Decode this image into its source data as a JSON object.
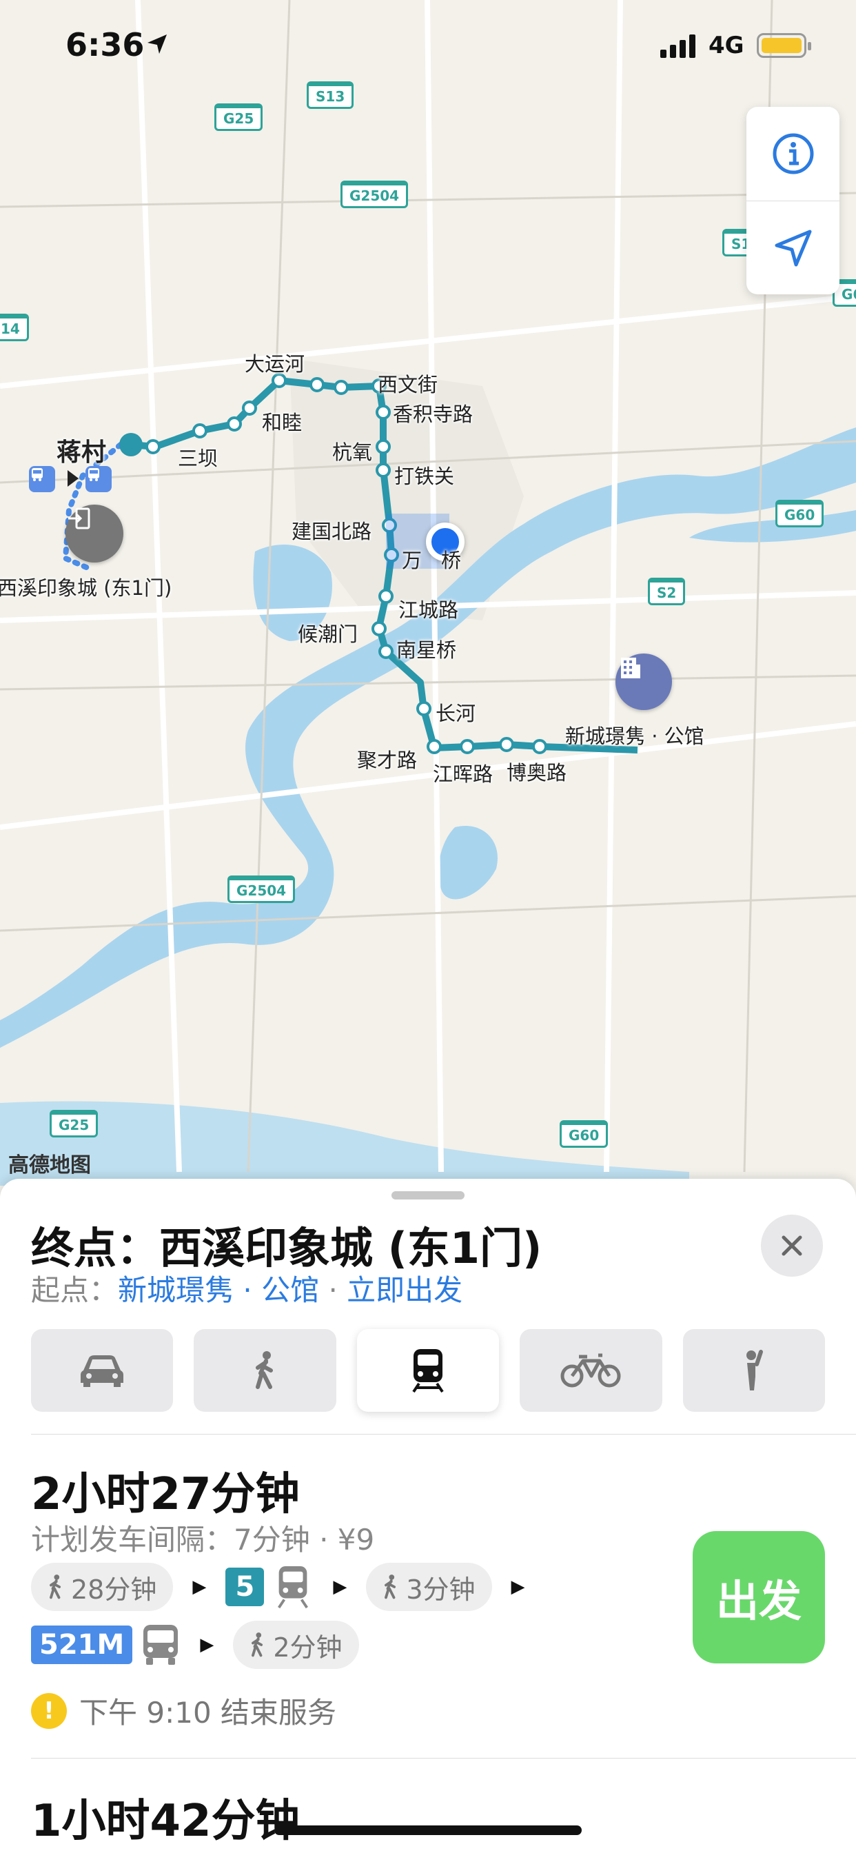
{
  "status": {
    "time": "6:36",
    "network": "4G"
  },
  "map": {
    "provider": "高德地图",
    "highways": [
      "S13",
      "G25",
      "G2504",
      "S1",
      "G6",
      "G60",
      "S2",
      "G2504",
      "G25",
      "G60",
      "14"
    ],
    "stations": [
      "大运河",
      "西文街",
      "香积寺路",
      "和睦",
      "三坝",
      "杭氧",
      "打铁关",
      "建国北路",
      "万",
      "桥",
      "江城路",
      "候潮门",
      "南星桥",
      "长河",
      "聚才路",
      "江晖路",
      "博奥路"
    ],
    "labels": {
      "start_place": "蒋村",
      "destination_pin": "西溪印象城 (东1门)",
      "origin_pin": "新城璟隽 · 公馆"
    }
  },
  "controls": {
    "info_icon": "info-icon",
    "locate_icon": "location-arrow-icon"
  },
  "sheet": {
    "title": "终点：西溪印象城 (东1门)",
    "start_prefix": "起点：",
    "start_value": "新城璟隽 · 公馆",
    "dot": "·",
    "depart_now": "立即出发",
    "modes": [
      "car",
      "walk",
      "transit",
      "bike",
      "ride-hail"
    ],
    "active_mode": "transit"
  },
  "routes": [
    {
      "duration": "2小时27分钟",
      "meta": "计划发车间隔：7分钟 · ¥9",
      "walk1": "28分钟",
      "metro_line": "5",
      "walk2": "3分钟",
      "bus_line": "521M",
      "walk3": "2分钟",
      "warning": "下午 9:10 结束服务",
      "go_label": "出发"
    },
    {
      "duration": "1小时42分钟"
    }
  ],
  "colors": {
    "route": "#2a97aa",
    "accent": "#2b7be0",
    "go": "#69d86b",
    "water": "#a9d4ee"
  }
}
